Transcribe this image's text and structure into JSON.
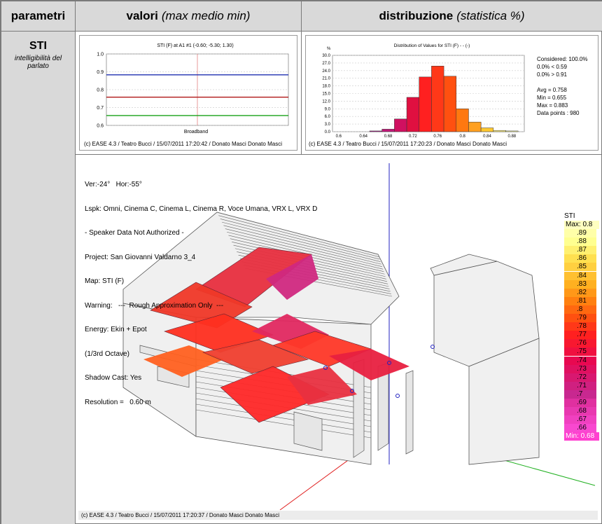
{
  "header": {
    "col1": "parametri",
    "col2_bold": "valori",
    "col2_italic": "(max medio min)",
    "col3_bold": "distribuzione",
    "col3_italic": "(statistica %)"
  },
  "parameter": {
    "name": "STI",
    "description_line1": "intelligibilità del",
    "description_line2": "parlato"
  },
  "line_chart": {
    "title": "STI (F) at A1 #1  (-0.60; -5.30; 1.30)",
    "xlabel": "Broadband",
    "footer": "(c) EASE 4.3  / Teatro Bucci  / 15/07/2011 17:20:42 / Donato Masci Donato Masci"
  },
  "hist_chart": {
    "title": "Distribution of Values for STI (F)  - - (-)",
    "ylabel": "%",
    "footer": "(c) EASE 4.3  / Teatro Bucci  / 15/07/2011 17:20:23 / Donato Masci Donato Masci",
    "stats": {
      "considered": "Considered: 100.0%",
      "below": "0.0%  < 0.59",
      "above": "0.0%  > 0.91",
      "avg": "Avg = 0.758",
      "min": "Min = 0.655",
      "max": "Max = 0.883",
      "points": "Data points : 980"
    }
  },
  "map_view": {
    "info_lines": [
      "Ver:-24°   Hor:-55°",
      "Lspk: Omni, Cinema C, Cinema L, Cinema R, Voce Umana, VRX L, VRX D",
      "- Speaker Data Not Authorized -",
      "Project: San Giovanni Valdarno 3_4",
      "Map: STI (F)",
      "Warning:   ---  Rough Approximation Only  ---",
      "Energy: Ekin + Epot",
      "(1/3rd Octave)",
      "Shadow Cast: Yes",
      "Resolution =   0.60 m"
    ],
    "footer": "(c) EASE 4.3  / Teatro Bucci  / 15/07/2011 17:20:37 / Donato Masci Donato Masci",
    "legend": {
      "title": "STI",
      "max_label": "Max:  0.8",
      "min_label": "Min:  0.68",
      "levels": [
        ".89",
        ".88",
        ".87",
        ".86",
        ".85",
        ".84",
        ".83",
        ".82",
        ".81",
        ".8",
        ".79",
        ".78",
        ".77",
        ".76",
        ".75",
        ".74",
        ".73",
        ".72",
        ".71",
        ".7",
        ".69",
        ".68",
        ".67",
        ".66"
      ],
      "colors": [
        "#ffffa8",
        "#ffff90",
        "#fff070",
        "#ffe050",
        "#ffd040",
        "#ffc030",
        "#ffb020",
        "#ff9818",
        "#ff8010",
        "#ff6810",
        "#ff5010",
        "#ff3818",
        "#ff2020",
        "#f81830",
        "#f01040",
        "#e80850",
        "#e01060",
        "#d81870",
        "#d02080",
        "#c82890",
        "#e030a0",
        "#e838b0",
        "#f040c0",
        "#f848d0"
      ]
    }
  },
  "chart_data": [
    {
      "type": "line",
      "title": "STI (F) at A1 #1  (-0.60; -5.30; 1.30)",
      "xlabel": "Broadband",
      "ylabel": "",
      "ylim": [
        0.6,
        1.0
      ],
      "yticks": [
        "1.0",
        "0.9",
        "0.8",
        "0.7",
        "0.6"
      ],
      "grid": true,
      "series": [
        {
          "color": "#1f2fb0",
          "value": 0.883
        },
        {
          "color": "#b01818",
          "value": 0.758
        },
        {
          "color": "#18a018",
          "value": 0.655
        }
      ]
    },
    {
      "type": "bar",
      "title": "Distribution of Values for STI (F)  - - (-)",
      "ylabel": "%",
      "ylim": [
        0,
        30
      ],
      "yticks": [
        "30.0",
        "27.0",
        "24.0",
        "21.0",
        "18.0",
        "15.0",
        "12.0",
        "9.0",
        "6.0",
        "3.0",
        "0.0"
      ],
      "xticks": [
        "0.6",
        "0.64",
        "0.68",
        "0.72",
        "0.76",
        "0.8",
        "0.84",
        "0.88"
      ],
      "bin_width": 0.02,
      "bins": [
        0.66,
        0.68,
        0.7,
        0.72,
        0.74,
        0.76,
        0.78,
        0.8,
        0.82,
        0.84,
        0.86,
        0.88
      ],
      "values": [
        0.3,
        1.0,
        5.0,
        13.5,
        21.5,
        25.8,
        21.8,
        9.0,
        3.8,
        1.5,
        0.5,
        0.3
      ],
      "colors": [
        "#b02090",
        "#c01878",
        "#d01060",
        "#e01040",
        "#ff2020",
        "#ff3818",
        "#ff5010",
        "#ff7810",
        "#ffa020",
        "#ffc830",
        "#fff080",
        "#ffffa8"
      ]
    }
  ]
}
